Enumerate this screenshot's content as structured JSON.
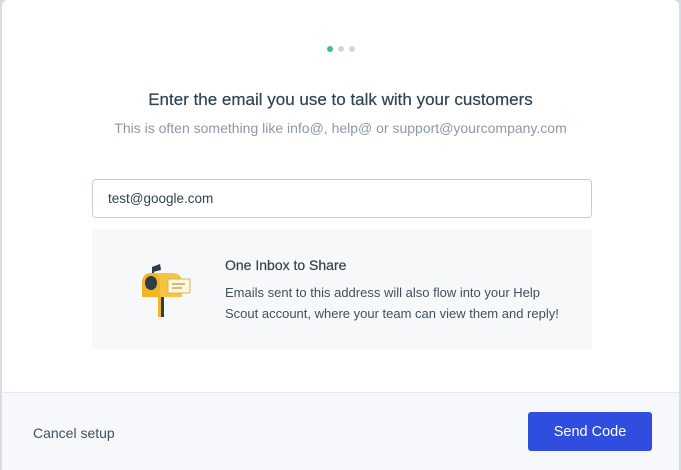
{
  "stepper": {
    "steps": 3,
    "active": 1,
    "active_color": "#3fbf7f"
  },
  "header": {
    "title": "Enter the email you use to talk with your customers",
    "subtitle": "This is often something like info@, help@ or support@yourcompany.com"
  },
  "email": {
    "value": "test@google.com",
    "placeholder": ""
  },
  "info": {
    "icon": "mailbox-icon",
    "title": "One Inbox to Share",
    "text": "Emails sent to this address will also flow into your Help Scout account, where your team can view them and reply!"
  },
  "footer": {
    "cancel_label": "Cancel setup",
    "send_label": "Send Code",
    "send_color": "#2f4ee0"
  }
}
